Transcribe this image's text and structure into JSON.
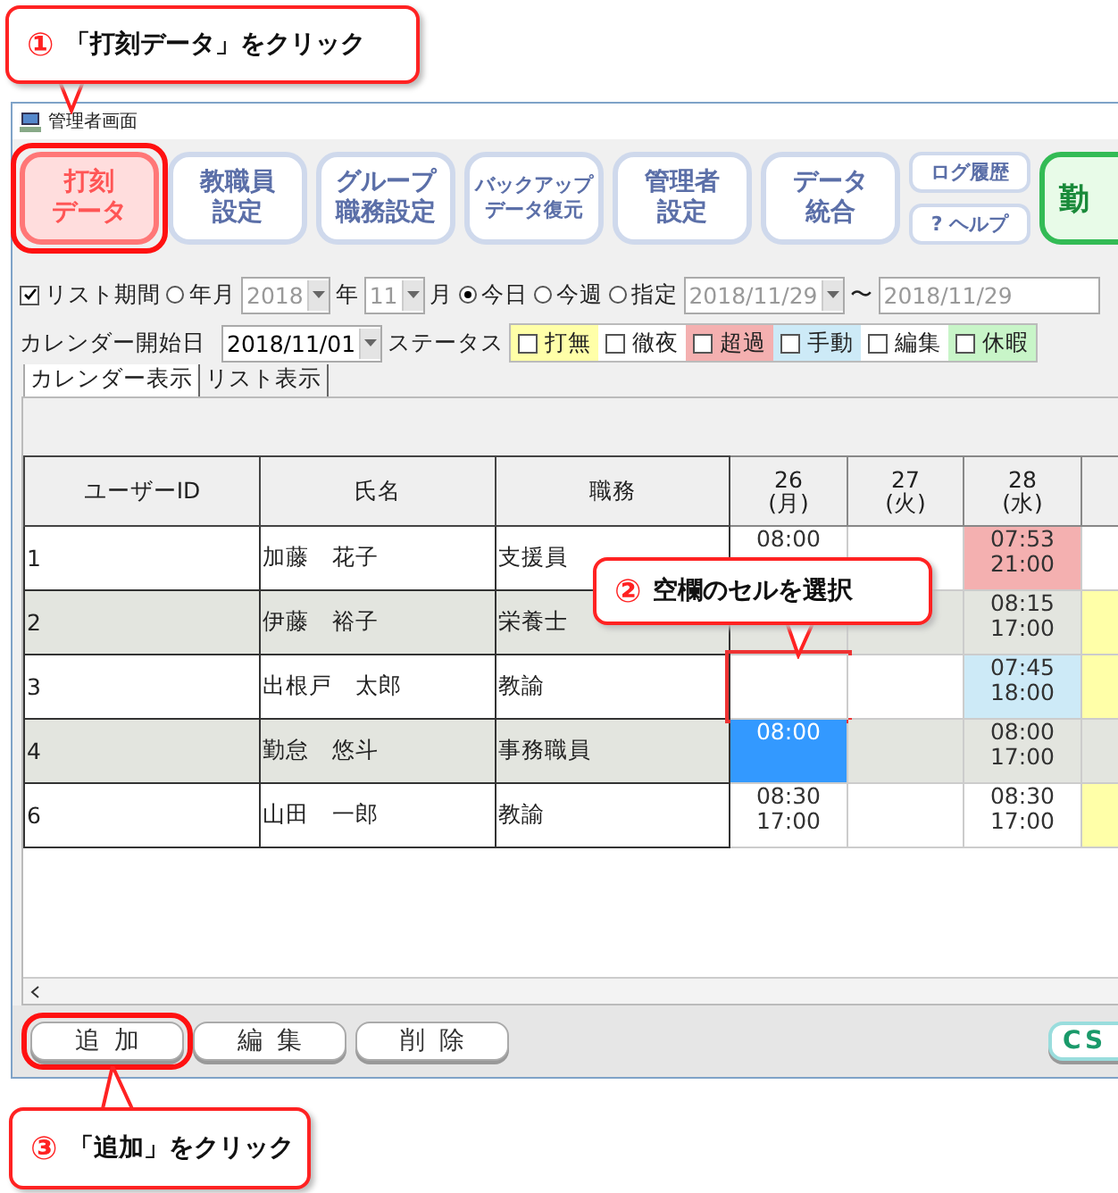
{
  "callouts": [
    {
      "number": "①",
      "text": "「打刻データ」をクリック"
    },
    {
      "number": "②",
      "text": "空欄のセルを選択"
    },
    {
      "number": "③",
      "text": "「追加」をクリック"
    }
  ],
  "window": {
    "title": "管理者画面"
  },
  "toolbar": [
    {
      "lines": [
        "打刻",
        "データ"
      ],
      "selected": true,
      "highlighted": true,
      "kind": "big"
    },
    {
      "lines": [
        "教職員",
        "設定"
      ],
      "selected": false,
      "highlighted": false,
      "kind": "big"
    },
    {
      "lines": [
        "グループ",
        "職務設定"
      ],
      "selected": false,
      "highlighted": false,
      "kind": "big"
    },
    {
      "lines": [
        "バックアップ",
        "データ復元"
      ],
      "selected": false,
      "highlighted": false,
      "kind": "big"
    },
    {
      "lines": [
        "管理者",
        "設定"
      ],
      "selected": false,
      "highlighted": false,
      "kind": "big"
    },
    {
      "lines": [
        "データ",
        "統合"
      ],
      "selected": false,
      "highlighted": false,
      "kind": "big"
    },
    {
      "lines": [
        "ログ履歴"
      ],
      "selected": false,
      "highlighted": false,
      "kind": "small"
    },
    {
      "lines": [
        "? ヘルプ"
      ],
      "selected": false,
      "highlighted": false,
      "kind": "small"
    },
    {
      "lines": [
        "勤"
      ],
      "selected": false,
      "highlighted": false,
      "kind": "green"
    }
  ],
  "filter": {
    "list_period": {
      "label": "リスト期間",
      "checked": true
    },
    "radios": [
      {
        "label": "年月",
        "selected": false
      },
      {
        "label": "今日",
        "selected": true
      },
      {
        "label": "今週",
        "selected": false
      },
      {
        "label": "指定",
        "selected": false
      }
    ],
    "year": "2018",
    "year_unit": "年",
    "month": "11",
    "month_unit": "月",
    "from": "2018/11/29",
    "tilde": "〜",
    "to": "2018/11/29"
  },
  "calendar_start": {
    "label": "カレンダー開始日",
    "value": "2018/11/01"
  },
  "status": {
    "label": "ステータス",
    "items": [
      {
        "label": "打無",
        "checked": false,
        "color": "#ffffa8"
      },
      {
        "label": "徹夜",
        "checked": false,
        "color": "#ffffff"
      },
      {
        "label": "超過",
        "checked": false,
        "color": "#f4b0b0"
      },
      {
        "label": "手動",
        "checked": false,
        "color": "#cdeaf7"
      },
      {
        "label": "編集",
        "checked": false,
        "color": "#ffffff"
      },
      {
        "label": "休暇",
        "checked": false,
        "color": "#c8f5c8"
      }
    ]
  },
  "tabs": [
    {
      "label": "カレンダー表示",
      "selected": true
    },
    {
      "label": "リスト表示",
      "selected": false
    }
  ],
  "table": {
    "columns": [
      "ユーザーID",
      "氏名",
      "職務"
    ],
    "days": [
      {
        "day": "26",
        "weekday": "(月)"
      },
      {
        "day": "27",
        "weekday": "(火)"
      },
      {
        "day": "28",
        "weekday": "(水)"
      }
    ],
    "rows": [
      {
        "id": "1",
        "name": "加藤　花子",
        "role": "支援員",
        "cells": [
          {
            "time_in": "08:00",
            "color": "#ffffff",
            "selected": false,
            "highlighted": false
          },
          {
            "color": "#ffffff",
            "selected": false,
            "highlighted": false
          },
          {
            "time_in": "07:53",
            "time_out": "21:00",
            "color": "#f4b0b0",
            "selected": false,
            "highlighted": false
          },
          {
            "color": "#ffffff",
            "selected": false,
            "highlighted": false
          }
        ]
      },
      {
        "id": "2",
        "name": "伊藤　裕子",
        "role": "栄養士",
        "cells": [
          {
            "color": "#e3e5df",
            "selected": false,
            "highlighted": false
          },
          {
            "color": "#e3e5df",
            "selected": false,
            "highlighted": false
          },
          {
            "time_in": "08:15",
            "time_out": "17:00",
            "color": "#e3e5df",
            "selected": false,
            "highlighted": false
          },
          {
            "color": "#ffffa8",
            "selected": false,
            "highlighted": false
          }
        ]
      },
      {
        "id": "3",
        "name": "出根戸　太郎",
        "role": "教諭",
        "cells": [
          {
            "color": "#ffffff",
            "selected": false,
            "highlighted": true
          },
          {
            "color": "#ffffff",
            "selected": false,
            "highlighted": false
          },
          {
            "time_in": "07:45",
            "time_out": "18:00",
            "color": "#cdeaf7",
            "selected": false,
            "highlighted": false
          },
          {
            "color": "#ffffa8",
            "selected": false,
            "highlighted": false
          }
        ]
      },
      {
        "id": "4",
        "name": "勤怠　悠斗",
        "role": "事務職員",
        "cells": [
          {
            "time_in": "08:00",
            "selected": true,
            "highlighted": false
          },
          {
            "color": "#e3e5df",
            "selected": false,
            "highlighted": false
          },
          {
            "time_in": "08:00",
            "time_out": "17:00",
            "color": "#e3e5df",
            "selected": false,
            "highlighted": false
          },
          {
            "color": "#e3e5df",
            "selected": false,
            "highlighted": false
          }
        ]
      },
      {
        "id": "6",
        "name": "山田　一郎",
        "role": "教諭",
        "cells": [
          {
            "time_in": "08:30",
            "time_out": "17:00",
            "color": "#ffffff",
            "selected": false,
            "highlighted": false
          },
          {
            "color": "#ffffff",
            "selected": false,
            "highlighted": false
          },
          {
            "time_in": "08:30",
            "time_out": "17:00",
            "color": "#ffffff",
            "selected": false,
            "highlighted": false
          },
          {
            "color": "#ffffa8",
            "selected": false,
            "highlighted": false
          }
        ]
      }
    ]
  },
  "actions": [
    {
      "label": "追加",
      "kind": "plain",
      "highlighted": true
    },
    {
      "label": "編集",
      "kind": "plain",
      "highlighted": false
    },
    {
      "label": "削除",
      "kind": "plain",
      "highlighted": false
    },
    {
      "label": "CS",
      "kind": "green",
      "highlighted": false
    }
  ]
}
